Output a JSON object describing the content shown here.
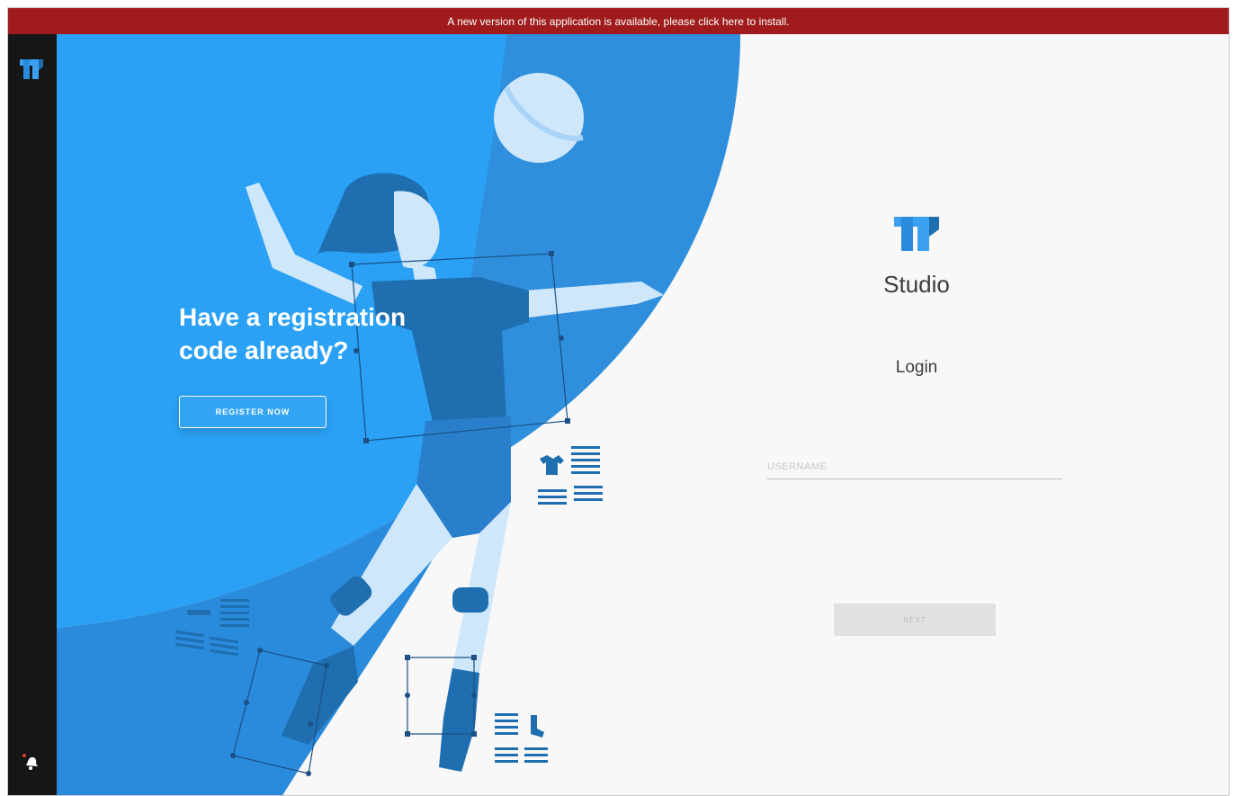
{
  "banner": {
    "text": "A new version of this application is available, please click here to install."
  },
  "sidebar": {
    "logo_icon": "app-logo-icon",
    "bottom_icon": "notification-bell-icon"
  },
  "promo": {
    "title": "Have a registration code already?",
    "register_label": "REGISTER NOW"
  },
  "login": {
    "app_name": "Studio",
    "heading": "Login",
    "username_placeholder": "USERNAME",
    "username_value": "",
    "next_label": "NEXT"
  },
  "colors": {
    "banner": "#a01c1c",
    "sidebar": "#161616",
    "hero_blue": "#2aa1f5",
    "hero_dark_blue": "#2a8bdc",
    "figure_dark": "#1f6fb0",
    "figure_light": "#cfe7fb",
    "panel_bg": "#f8f8f8",
    "brand": "#2f94e8"
  }
}
